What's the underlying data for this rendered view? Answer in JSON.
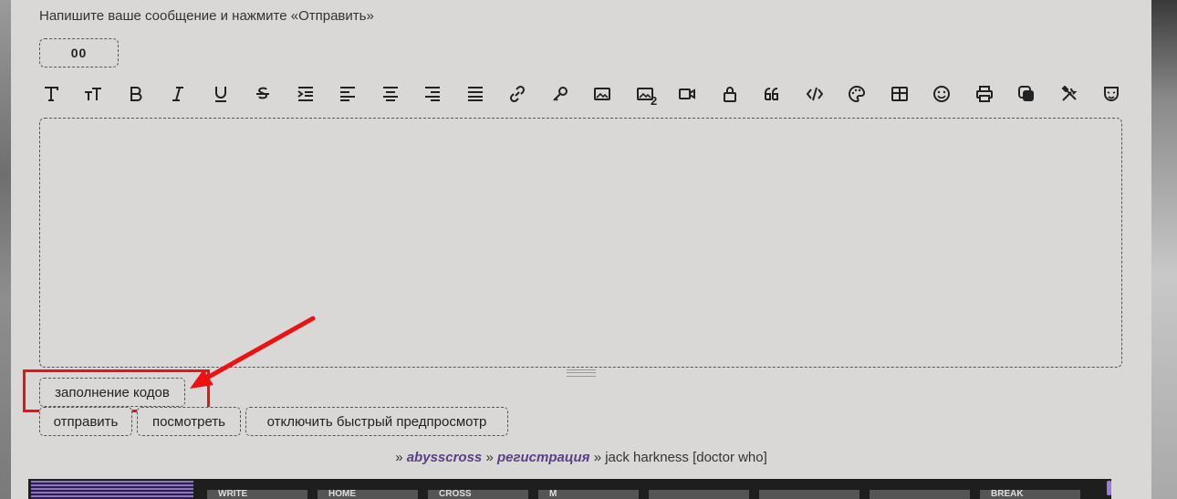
{
  "hint": "Напишите ваше сообщение и нажмите «Отправить»",
  "code_box": "00",
  "toolbar": {
    "icons": [
      "font-icon",
      "font-size-icon",
      "bold-icon",
      "italic-icon",
      "underline-icon",
      "strikethrough-icon",
      "indent-icon",
      "align-left-icon",
      "align-center-icon",
      "align-right-icon",
      "align-justify-icon",
      "link-icon",
      "key-icon",
      "image-icon",
      "image-2-icon",
      "video-icon",
      "lock-icon",
      "quote-icon",
      "code-icon",
      "palette-icon",
      "table-icon",
      "smiley-icon",
      "print-icon",
      "layers-icon",
      "tools-icon",
      "mask-icon"
    ],
    "image2_sub": "2"
  },
  "editor": {
    "value": "",
    "placeholder": ""
  },
  "buttons": {
    "fill_codes": "заполнение кодов",
    "send": "отправить",
    "preview": "посмотреть",
    "disable_quick_preview": "отключить быстрый предпросмотр"
  },
  "breadcrumbs": {
    "sep": "»",
    "forum": "abysscross",
    "section": "регистрация",
    "topic": "jack harkness [doctor who]"
  },
  "banners": [
    "",
    "WRITE",
    "HOME",
    "CROSS",
    "M",
    "",
    "",
    "",
    "",
    "BREAK"
  ],
  "colors": {
    "highlight": "#ef1111",
    "link": "#5b3f86",
    "panel": "#d9d8d7"
  }
}
